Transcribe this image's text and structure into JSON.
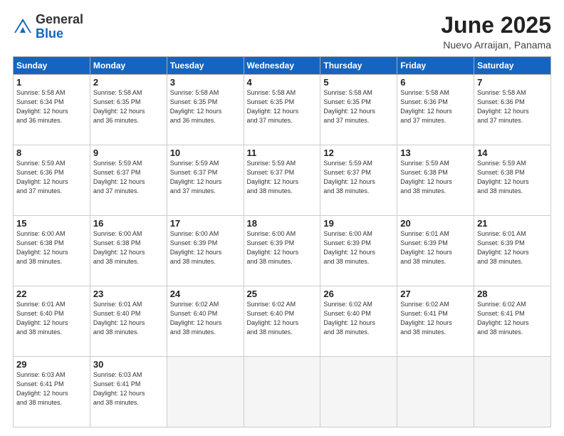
{
  "logo": {
    "general": "General",
    "blue": "Blue"
  },
  "title": "June 2025",
  "subtitle": "Nuevo Arraijan, Panama",
  "headers": [
    "Sunday",
    "Monday",
    "Tuesday",
    "Wednesday",
    "Thursday",
    "Friday",
    "Saturday"
  ],
  "weeks": [
    [
      {
        "day": "1",
        "info": "Sunrise: 5:58 AM\nSunset: 6:34 PM\nDaylight: 12 hours\nand 36 minutes."
      },
      {
        "day": "2",
        "info": "Sunrise: 5:58 AM\nSunset: 6:35 PM\nDaylight: 12 hours\nand 36 minutes."
      },
      {
        "day": "3",
        "info": "Sunrise: 5:58 AM\nSunset: 6:35 PM\nDaylight: 12 hours\nand 36 minutes."
      },
      {
        "day": "4",
        "info": "Sunrise: 5:58 AM\nSunset: 6:35 PM\nDaylight: 12 hours\nand 37 minutes."
      },
      {
        "day": "5",
        "info": "Sunrise: 5:58 AM\nSunset: 6:35 PM\nDaylight: 12 hours\nand 37 minutes."
      },
      {
        "day": "6",
        "info": "Sunrise: 5:58 AM\nSunset: 6:36 PM\nDaylight: 12 hours\nand 37 minutes."
      },
      {
        "day": "7",
        "info": "Sunrise: 5:58 AM\nSunset: 6:36 PM\nDaylight: 12 hours\nand 37 minutes."
      }
    ],
    [
      {
        "day": "8",
        "info": "Sunrise: 5:59 AM\nSunset: 6:36 PM\nDaylight: 12 hours\nand 37 minutes."
      },
      {
        "day": "9",
        "info": "Sunrise: 5:59 AM\nSunset: 6:37 PM\nDaylight: 12 hours\nand 37 minutes."
      },
      {
        "day": "10",
        "info": "Sunrise: 5:59 AM\nSunset: 6:37 PM\nDaylight: 12 hours\nand 37 minutes."
      },
      {
        "day": "11",
        "info": "Sunrise: 5:59 AM\nSunset: 6:37 PM\nDaylight: 12 hours\nand 38 minutes."
      },
      {
        "day": "12",
        "info": "Sunrise: 5:59 AM\nSunset: 6:37 PM\nDaylight: 12 hours\nand 38 minutes."
      },
      {
        "day": "13",
        "info": "Sunrise: 5:59 AM\nSunset: 6:38 PM\nDaylight: 12 hours\nand 38 minutes."
      },
      {
        "day": "14",
        "info": "Sunrise: 5:59 AM\nSunset: 6:38 PM\nDaylight: 12 hours\nand 38 minutes."
      }
    ],
    [
      {
        "day": "15",
        "info": "Sunrise: 6:00 AM\nSunset: 6:38 PM\nDaylight: 12 hours\nand 38 minutes."
      },
      {
        "day": "16",
        "info": "Sunrise: 6:00 AM\nSunset: 6:38 PM\nDaylight: 12 hours\nand 38 minutes."
      },
      {
        "day": "17",
        "info": "Sunrise: 6:00 AM\nSunset: 6:39 PM\nDaylight: 12 hours\nand 38 minutes."
      },
      {
        "day": "18",
        "info": "Sunrise: 6:00 AM\nSunset: 6:39 PM\nDaylight: 12 hours\nand 38 minutes."
      },
      {
        "day": "19",
        "info": "Sunrise: 6:00 AM\nSunset: 6:39 PM\nDaylight: 12 hours\nand 38 minutes."
      },
      {
        "day": "20",
        "info": "Sunrise: 6:01 AM\nSunset: 6:39 PM\nDaylight: 12 hours\nand 38 minutes."
      },
      {
        "day": "21",
        "info": "Sunrise: 6:01 AM\nSunset: 6:39 PM\nDaylight: 12 hours\nand 38 minutes."
      }
    ],
    [
      {
        "day": "22",
        "info": "Sunrise: 6:01 AM\nSunset: 6:40 PM\nDaylight: 12 hours\nand 38 minutes."
      },
      {
        "day": "23",
        "info": "Sunrise: 6:01 AM\nSunset: 6:40 PM\nDaylight: 12 hours\nand 38 minutes."
      },
      {
        "day": "24",
        "info": "Sunrise: 6:02 AM\nSunset: 6:40 PM\nDaylight: 12 hours\nand 38 minutes."
      },
      {
        "day": "25",
        "info": "Sunrise: 6:02 AM\nSunset: 6:40 PM\nDaylight: 12 hours\nand 38 minutes."
      },
      {
        "day": "26",
        "info": "Sunrise: 6:02 AM\nSunset: 6:40 PM\nDaylight: 12 hours\nand 38 minutes."
      },
      {
        "day": "27",
        "info": "Sunrise: 6:02 AM\nSunset: 6:41 PM\nDaylight: 12 hours\nand 38 minutes."
      },
      {
        "day": "28",
        "info": "Sunrise: 6:02 AM\nSunset: 6:41 PM\nDaylight: 12 hours\nand 38 minutes."
      }
    ],
    [
      {
        "day": "29",
        "info": "Sunrise: 6:03 AM\nSunset: 6:41 PM\nDaylight: 12 hours\nand 38 minutes."
      },
      {
        "day": "30",
        "info": "Sunrise: 6:03 AM\nSunset: 6:41 PM\nDaylight: 12 hours\nand 38 minutes."
      },
      {
        "day": "",
        "info": ""
      },
      {
        "day": "",
        "info": ""
      },
      {
        "day": "",
        "info": ""
      },
      {
        "day": "",
        "info": ""
      },
      {
        "day": "",
        "info": ""
      }
    ]
  ]
}
